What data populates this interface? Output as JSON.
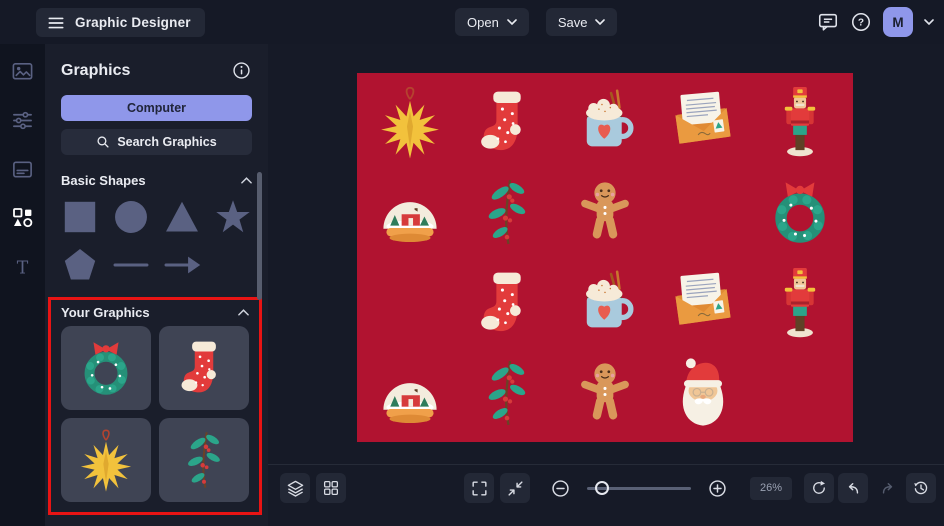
{
  "topbar": {
    "title": "Graphic Designer",
    "open_label": "Open",
    "save_label": "Save",
    "avatar_initial": "M"
  },
  "rail": {
    "items": [
      "image-icon",
      "adjustments-icon",
      "layout-icon",
      "shapes-icon",
      "text-icon"
    ],
    "active_item": "shapes-icon"
  },
  "panel": {
    "title": "Graphics",
    "computer_button": "Computer",
    "search_button": "Search Graphics",
    "basic_shapes": {
      "title": "Basic Shapes",
      "shapes": [
        "square",
        "circle",
        "triangle",
        "star",
        "pentagon",
        "line",
        "arrow"
      ]
    },
    "your_graphics": {
      "title": "Your Graphics",
      "items": [
        "wreath",
        "stocking",
        "star-ornament",
        "holly"
      ],
      "highlighted": true
    }
  },
  "canvas": {
    "background": "#b11330",
    "grid": {
      "columns": 5,
      "rows": 4,
      "cells": [
        [
          "star-ornament",
          "stocking",
          "cocoa-mug",
          "santa-letter",
          "nutcracker"
        ],
        [
          "snow-globe",
          "holly",
          "gingerbread",
          "",
          "wreath"
        ],
        [
          "",
          "stocking",
          "cocoa-mug",
          "santa-letter",
          "nutcracker"
        ],
        [
          "snow-globe",
          "holly",
          "gingerbread",
          "santa-face",
          ""
        ]
      ]
    }
  },
  "toolbar": {
    "zoom_level": "26%",
    "left_icons": [
      "layers-icon",
      "grid-icon"
    ],
    "center_icons": [
      "expand-icon",
      "fit-screen-icon",
      "zoom-out-icon",
      "zoom-in-icon"
    ],
    "right_icons": [
      "refresh-icon",
      "undo-icon",
      "redo-icon",
      "history-icon"
    ]
  },
  "colors": {
    "accent": "#8f97ea",
    "canvas_red": "#b11330",
    "highlight_red": "#e81414"
  }
}
